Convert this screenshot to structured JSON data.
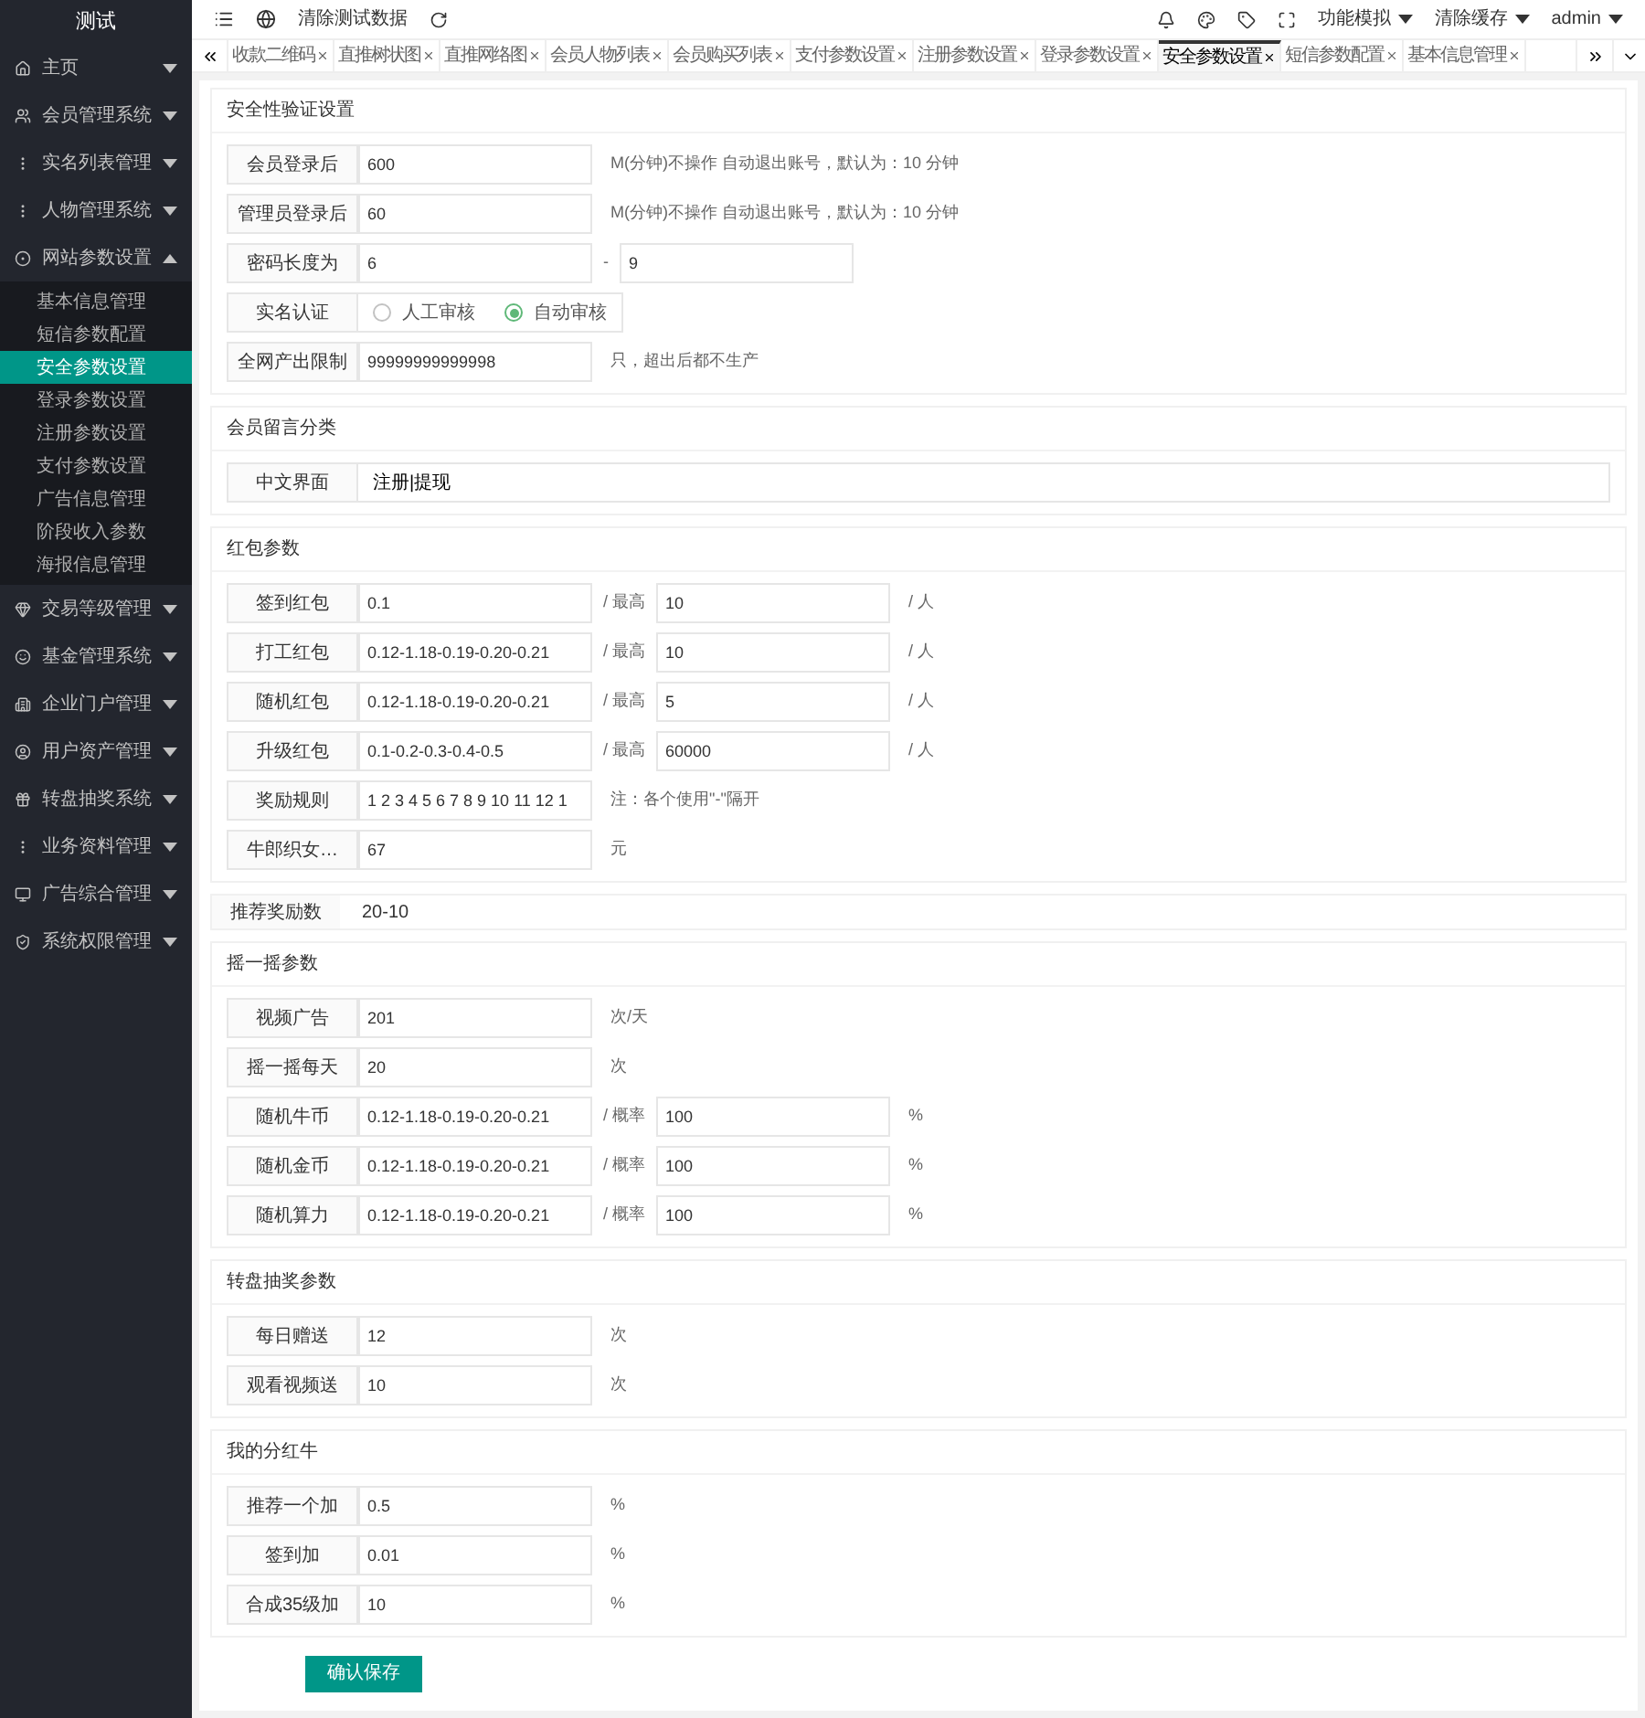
{
  "sidebar": {
    "title": "测试",
    "items": [
      {
        "label": "主页",
        "expanded": false
      },
      {
        "label": "会员管理系统",
        "expanded": false
      },
      {
        "label": "实名列表管理",
        "expanded": false
      },
      {
        "label": "人物管理系统",
        "expanded": false
      },
      {
        "label": "网站参数设置",
        "expanded": true,
        "children": [
          {
            "label": "基本信息管理",
            "selected": false
          },
          {
            "label": "短信参数配置",
            "selected": false
          },
          {
            "label": "安全参数设置",
            "selected": true
          },
          {
            "label": "登录参数设置",
            "selected": false
          },
          {
            "label": "注册参数设置",
            "selected": false
          },
          {
            "label": "支付参数设置",
            "selected": false
          },
          {
            "label": "广告信息管理",
            "selected": false
          },
          {
            "label": "阶段收入参数",
            "selected": false
          },
          {
            "label": "海报信息管理",
            "selected": false
          }
        ]
      },
      {
        "label": "交易等级管理",
        "expanded": false
      },
      {
        "label": "基金管理系统",
        "expanded": false
      },
      {
        "label": "企业门户管理",
        "expanded": false
      },
      {
        "label": "用户资产管理",
        "expanded": false
      },
      {
        "label": "转盘抽奖系统",
        "expanded": false
      },
      {
        "label": "业务资料管理",
        "expanded": false
      },
      {
        "label": "广告综合管理",
        "expanded": false
      },
      {
        "label": "系统权限管理",
        "expanded": false
      }
    ]
  },
  "topbar": {
    "clear_button": "清除测试数据",
    "menus": [
      "功能模拟",
      "清除缓存",
      "admin"
    ]
  },
  "tabs": [
    {
      "label": "收款二维码",
      "selected": false
    },
    {
      "label": "直推树状图",
      "selected": false
    },
    {
      "label": "直推网络图",
      "selected": false
    },
    {
      "label": "会员人物列表",
      "selected": false
    },
    {
      "label": "会员购买列表",
      "selected": false
    },
    {
      "label": "支付参数设置",
      "selected": false
    },
    {
      "label": "注册参数设置",
      "selected": false
    },
    {
      "label": "登录参数设置",
      "selected": false
    },
    {
      "label": "安全参数设置",
      "selected": true
    },
    {
      "label": "短信参数配置",
      "selected": false
    },
    {
      "label": "基本信息管理",
      "selected": false
    }
  ],
  "blocks": [
    {
      "kind": "section",
      "title": "安全性验证设置",
      "rows": [
        {
          "kind": "field",
          "label": "会员登录后",
          "value": "600",
          "note": "M(分钟)不操作 自动退出账号，默认为：10 分钟"
        },
        {
          "kind": "field",
          "label": "管理员登录后",
          "value": "60",
          "note": "M(分钟)不操作 自动退出账号，默认为：10 分钟"
        },
        {
          "kind": "pair",
          "label": "密码长度为",
          "value": "6",
          "mid": "-",
          "value2": "9"
        },
        {
          "kind": "radio",
          "label": "实名认证",
          "options": [
            {
              "label": "人工审核",
              "selected": false
            },
            {
              "label": "自动审核",
              "selected": true
            }
          ]
        },
        {
          "kind": "field",
          "label": "全网产出限制",
          "value": "99999999999998",
          "note": "只，超出后都不生产"
        }
      ]
    },
    {
      "kind": "section",
      "title": "会员留言分类",
      "rows": [
        {
          "kind": "wide",
          "label": "中文界面",
          "value": "注册|提现"
        }
      ]
    },
    {
      "kind": "section",
      "title": "红包参数",
      "rows": [
        {
          "kind": "pair",
          "label": "签到红包",
          "value": "0.1",
          "mid": "/ 最高",
          "value2": "10",
          "unit": "/ 人"
        },
        {
          "kind": "pair",
          "label": "打工红包",
          "value": "0.12-1.18-0.19-0.20-0.21",
          "mid": "/ 最高",
          "value2": "10",
          "unit": "/ 人"
        },
        {
          "kind": "pair",
          "label": "随机红包",
          "value": "0.12-1.18-0.19-0.20-0.21",
          "mid": "/ 最高",
          "value2": "5",
          "unit": "/ 人"
        },
        {
          "kind": "pair",
          "label": "升级红包",
          "value": "0.1-0.2-0.3-0.4-0.5",
          "mid": "/ 最高",
          "value2": "60000",
          "unit": "/ 人"
        },
        {
          "kind": "field",
          "label": "奖励规则",
          "value": "1 2 3 4 5 6 7 8 9 10 11 12 1",
          "note": "注：各个使用\"-\"隔开"
        },
        {
          "kind": "field",
          "label": "牛郎织女…",
          "value": "67",
          "note": "元"
        }
      ]
    },
    {
      "kind": "plain",
      "label": "推荐奖励数",
      "value": "20-10"
    },
    {
      "kind": "section",
      "title": "摇一摇参数",
      "rows": [
        {
          "kind": "field",
          "label": "视频广告",
          "value": "201",
          "note": "次/天"
        },
        {
          "kind": "field",
          "label": "摇一摇每天",
          "value": "20",
          "note": "次"
        },
        {
          "kind": "pair",
          "label": "随机牛币",
          "value": "0.12-1.18-0.19-0.20-0.21",
          "mid": "/ 概率",
          "value2": "100",
          "unit": "%"
        },
        {
          "kind": "pair",
          "label": "随机金币",
          "value": "0.12-1.18-0.19-0.20-0.21",
          "mid": "/ 概率",
          "value2": "100",
          "unit": "%"
        },
        {
          "kind": "pair",
          "label": "随机算力",
          "value": "0.12-1.18-0.19-0.20-0.21",
          "mid": "/ 概率",
          "value2": "100",
          "unit": "%"
        }
      ]
    },
    {
      "kind": "section",
      "title": "转盘抽奖参数",
      "rows": [
        {
          "kind": "field",
          "label": "每日赠送",
          "value": "12",
          "note": "次"
        },
        {
          "kind": "field",
          "label": "观看视频送",
          "value": "10",
          "note": "次"
        }
      ]
    },
    {
      "kind": "section",
      "title": "我的分红牛",
      "rows": [
        {
          "kind": "field",
          "label": "推荐一个加",
          "value": "0.5",
          "note": "%"
        },
        {
          "kind": "field",
          "label": "签到加",
          "value": "0.01",
          "note": "%"
        },
        {
          "kind": "field",
          "label": "合成35级加",
          "value": "10",
          "note": "%"
        }
      ]
    }
  ],
  "save_button": "确认保存"
}
